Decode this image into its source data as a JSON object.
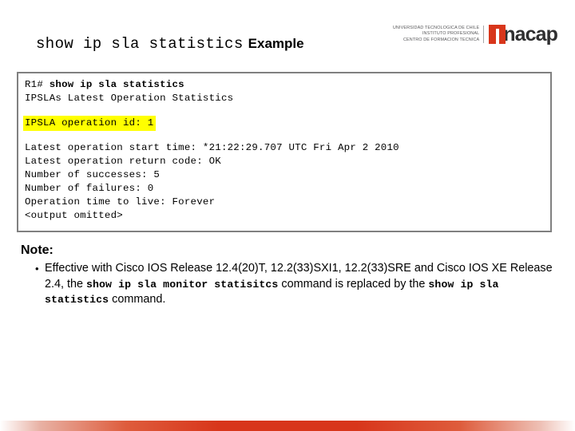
{
  "header": {
    "title_command": "show ip sla statistics",
    "title_word": "Example",
    "logo": {
      "line1": "UNIVERSIDAD TECNOLOGICA DE CHILE",
      "line2": "INSTITUTO PROFESIONAL",
      "line3": "CENTRO DE FORMACION TECNICA",
      "wordmark": "nacap",
      "accent_color": "#d8361b"
    }
  },
  "terminal": {
    "prompt": "R1# ",
    "prompt_command": "show ip sla statistics",
    "line_stats_header": "IPSLAs Latest Operation Statistics",
    "highlight_line": "IPSLA operation id: 1",
    "highlight_color": "#ffff00",
    "lines": [
      "Latest operation start time: *21:22:29.707 UTC Fri Apr 2 2010",
      "Latest operation return code: OK",
      "Number of successes: 5",
      "Number of failures: 0",
      "Operation time to live: Forever",
      "<output omitted>"
    ]
  },
  "note": {
    "heading": "Note:",
    "bullet_glyph": "•",
    "item": {
      "part1": "Effective with Cisco IOS Release 12.4(20)T, 12.2(33)SXI1, 12.2(33)SRE and Cisco IOS XE Release 2.4, the ",
      "code1": "show ip sla monitor statisitcs",
      "part2": " command is replaced by the ",
      "code2": "show ip sla statistics",
      "part3": " command."
    }
  },
  "footer": {
    "band_color": "#d8361b"
  }
}
